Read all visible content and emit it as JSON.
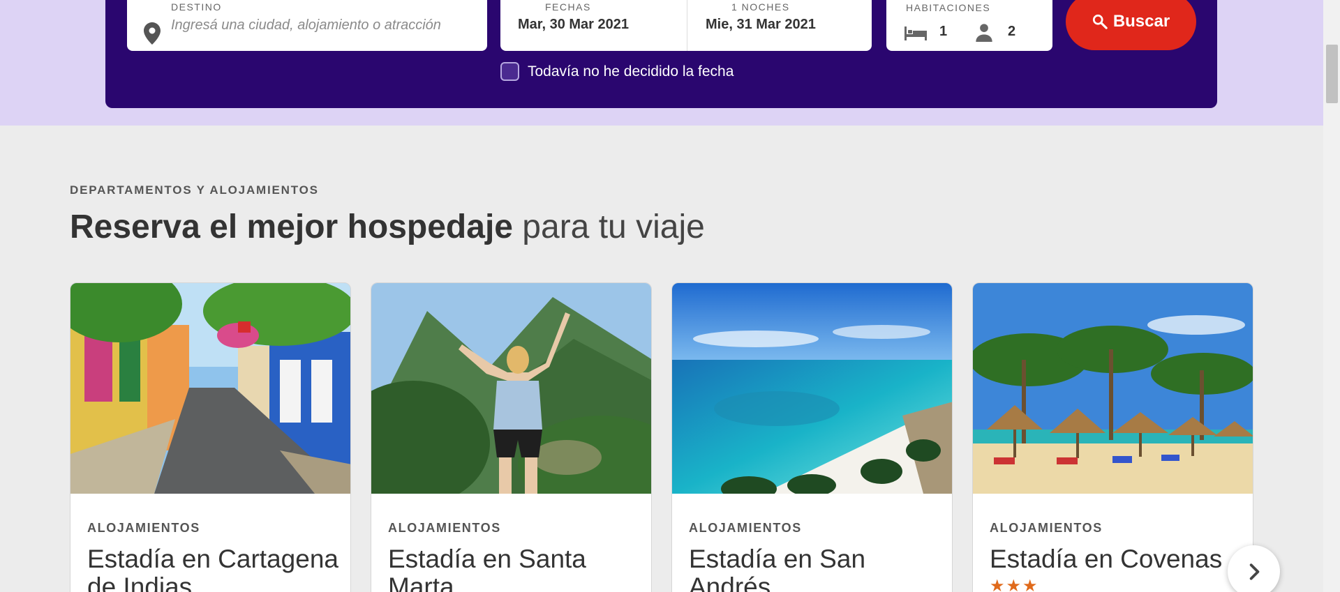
{
  "search": {
    "destination_label": "Destino",
    "destination_placeholder": "Ingresá una ciudad, alojamiento o atracción",
    "dates_label": "Fechas",
    "checkin": "Mar, 30 Mar 2021",
    "nights_label": "1 Noches",
    "checkout": "Mie, 31 Mar 2021",
    "rooms_label": "Habitaciones",
    "rooms_count": "1",
    "guests_count": "2",
    "search_button": "Buscar",
    "no_date_label": "Todavía no he decidido la fecha",
    "no_date_checked": false
  },
  "section": {
    "eyebrow": "Departamentos y alojamientos",
    "headline_bold": "Reserva el mejor hospedaje",
    "headline_light": " para tu viaje"
  },
  "cards": [
    {
      "category": "Alojamientos",
      "title": "Estadía en Cartagena de Indias"
    },
    {
      "category": "Alojamientos",
      "title": "Estadía en Santa Marta"
    },
    {
      "category": "Alojamientos",
      "title": "Estadía en San Andrés"
    },
    {
      "category": "Alojamientos",
      "title": "Estadía en Covenas",
      "stars": "★★★"
    }
  ],
  "colors": {
    "panel": "#2a066f",
    "band": "#ddd3f5",
    "button": "#e0271b",
    "stars": "#e06a1b"
  }
}
